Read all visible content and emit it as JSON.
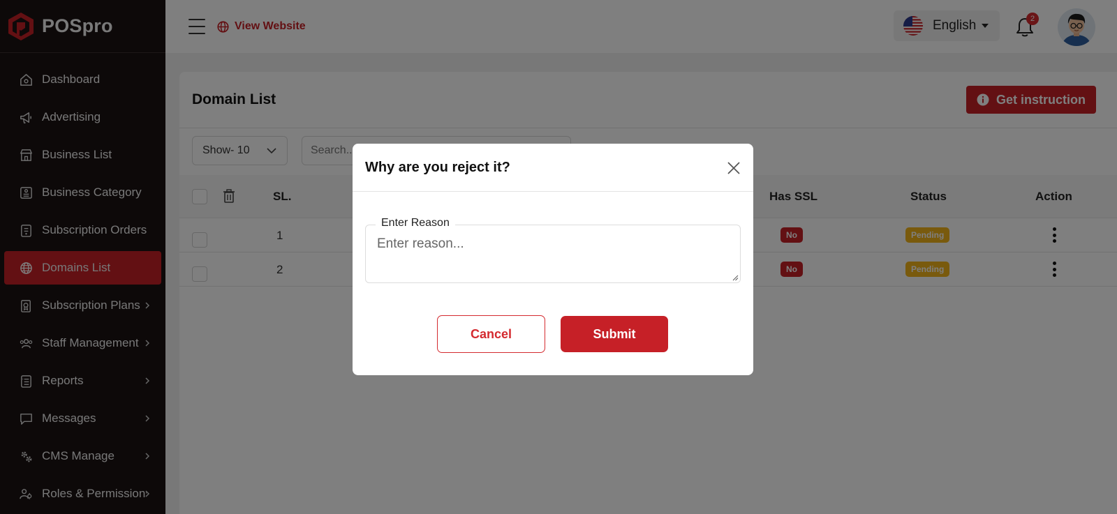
{
  "brand": {
    "name": "POSpro"
  },
  "colors": {
    "accent": "#c62027",
    "sidebar_bg": "#1a1213",
    "pending": "#f3b51b"
  },
  "sidebar": {
    "items": [
      {
        "label": "Dashboard",
        "icon": "home-icon",
        "active": false,
        "chevron": false
      },
      {
        "label": "Advertising",
        "icon": "megaphone-icon",
        "active": false,
        "chevron": false
      },
      {
        "label": "Business List",
        "icon": "store-icon",
        "active": false,
        "chevron": false
      },
      {
        "label": "Business Category",
        "icon": "category-icon",
        "active": false,
        "chevron": false
      },
      {
        "label": "Subscription Orders",
        "icon": "orders-icon",
        "active": false,
        "chevron": false
      },
      {
        "label": "Domains List",
        "icon": "globe-icon",
        "active": true,
        "chevron": false
      },
      {
        "label": "Subscription Plans",
        "icon": "plans-icon",
        "active": false,
        "chevron": true
      },
      {
        "label": "Staff Management",
        "icon": "staff-icon",
        "active": false,
        "chevron": true
      },
      {
        "label": "Reports",
        "icon": "reports-icon",
        "active": false,
        "chevron": true
      },
      {
        "label": "Messages",
        "icon": "message-icon",
        "active": false,
        "chevron": true
      },
      {
        "label": "CMS Manage",
        "icon": "gears-icon",
        "active": false,
        "chevron": true
      },
      {
        "label": "Roles & Permissions",
        "icon": "roles-icon",
        "active": false,
        "chevron": true
      }
    ]
  },
  "topbar": {
    "view_website": "View Website",
    "language": "English",
    "notification_count": "2"
  },
  "page": {
    "title": "Domain List",
    "instruction_button": "Get instruction",
    "show_select": "Show- 10",
    "search_placeholder": "Search..."
  },
  "table": {
    "columns": {
      "sl": "SL.",
      "has_ssl": "Has SSL",
      "status": "Status",
      "action": "Action"
    },
    "rows": [
      {
        "sl": "1",
        "has_ssl": "No",
        "status": "Pending"
      },
      {
        "sl": "2",
        "has_ssl": "No",
        "status": "Pending"
      }
    ]
  },
  "modal": {
    "title": "Why are you reject it?",
    "field_label": "Enter Reason",
    "field_placeholder": "Enter reason...",
    "field_value": "",
    "cancel": "Cancel",
    "submit": "Submit"
  }
}
